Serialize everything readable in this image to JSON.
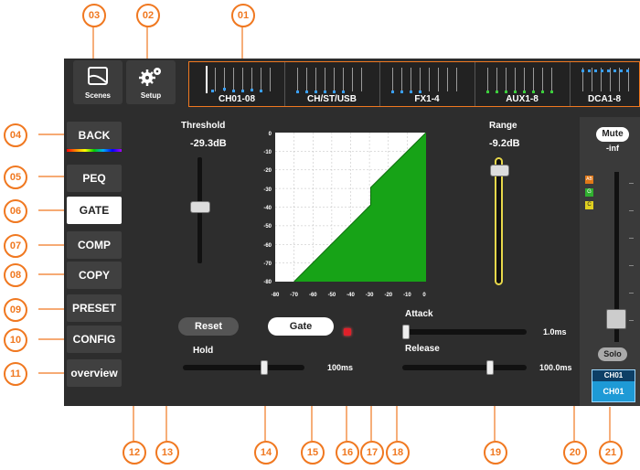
{
  "callouts": [
    "01",
    "02",
    "03",
    "04",
    "05",
    "06",
    "07",
    "08",
    "09",
    "10",
    "11",
    "12",
    "13",
    "14",
    "15",
    "16",
    "17",
    "18",
    "19",
    "20",
    "21"
  ],
  "topbar": {
    "scenes_label": "Scenes",
    "setup_label": "Setup",
    "groups": [
      "CH01-08",
      "CH/ST/USB",
      "FX1-4",
      "AUX1-8",
      "DCA1-8"
    ]
  },
  "menu": {
    "back": "BACK",
    "peq": "PEQ",
    "gate": "GATE",
    "comp": "COMP",
    "copy": "COPY",
    "preset": "PRESET",
    "config": "CONFIG",
    "overview": "overview"
  },
  "threshold": {
    "label": "Threshold",
    "value": "-29.3dB"
  },
  "range": {
    "label": "Range",
    "value": "-9.2dB"
  },
  "graph": {
    "y_ticks": [
      "0",
      "-10",
      "-20",
      "-30",
      "-40",
      "-50",
      "-60",
      "-70",
      "-80"
    ],
    "x_ticks": [
      "-80",
      "-70",
      "-60",
      "-50",
      "-40",
      "-30",
      "-20",
      "-10",
      "0"
    ]
  },
  "buttons": {
    "reset": "Reset",
    "gate": "Gate"
  },
  "hold": {
    "label": "Hold",
    "value": "100ms",
    "level": 0.68
  },
  "attack": {
    "label": "Attack",
    "value": "1.0ms",
    "level": 0.0
  },
  "release": {
    "label": "Release",
    "value": "100.0ms",
    "level": 0.72
  },
  "strip": {
    "mute_label": "Mute",
    "level_text": "-inf",
    "meter_badges": [
      "AB",
      "G",
      "C"
    ],
    "solo_label": "Solo",
    "channel_name": "CH01",
    "channel_id": "CH01"
  },
  "colors": {
    "accent": "#f07820",
    "gate_fill": "#17a317",
    "range_slider": "#e8d84a",
    "channel_blue": "#1e9ad6"
  }
}
